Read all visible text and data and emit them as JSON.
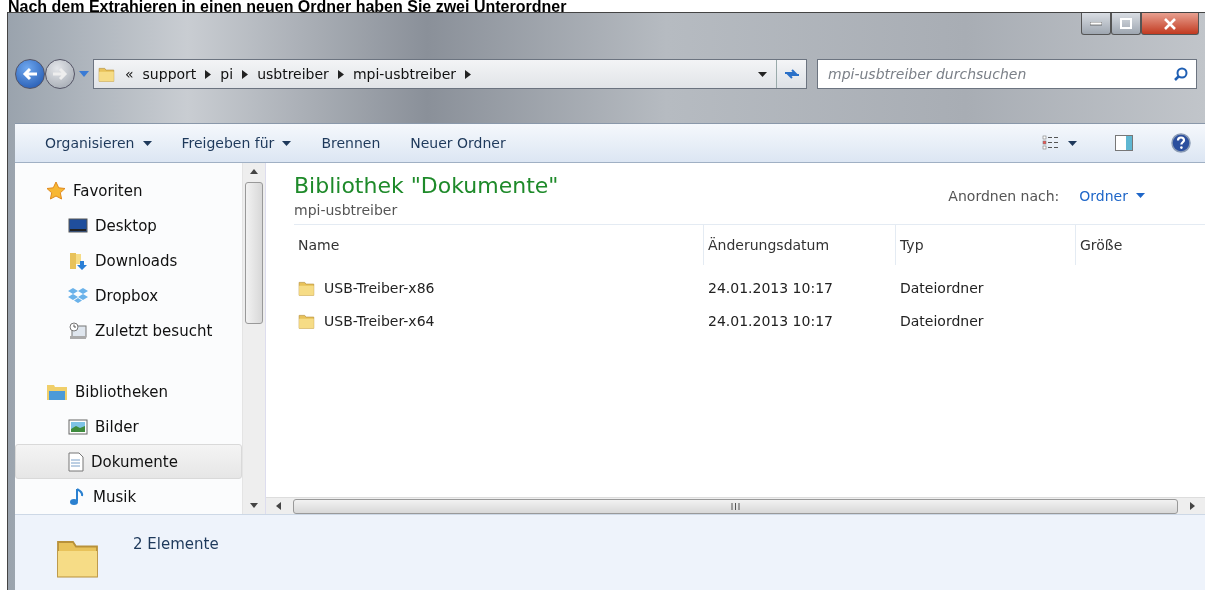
{
  "caption": "Nach dem Extrahieren in einen neuen Ordner haben Sie zwei Unterordner",
  "address": {
    "overflow": "«",
    "crumbs": [
      "support",
      "pi",
      "usbtreiber",
      "mpi-usbtreiber"
    ]
  },
  "search": {
    "placeholder": "mpi-usbtreiber durchsuchen"
  },
  "toolbar": [
    {
      "label": "Organisieren",
      "dropdown": true
    },
    {
      "label": "Freigeben für",
      "dropdown": true
    },
    {
      "label": "Brennen",
      "dropdown": false
    },
    {
      "label": "Neuer Ordner",
      "dropdown": false
    }
  ],
  "nav": [
    {
      "label": "Favoriten",
      "kind": "star",
      "selected": false,
      "children": [
        {
          "label": "Desktop",
          "kind": "desktop",
          "selected": false
        },
        {
          "label": "Downloads",
          "kind": "downloads",
          "selected": false
        },
        {
          "label": "Dropbox",
          "kind": "dropbox",
          "selected": false
        },
        {
          "label": "Zuletzt besucht",
          "kind": "recent",
          "selected": false
        }
      ]
    },
    {
      "label": "Bibliotheken",
      "kind": "library",
      "selected": false,
      "children": [
        {
          "label": "Bilder",
          "kind": "pictures",
          "selected": false
        },
        {
          "label": "Dokumente",
          "kind": "documents",
          "selected": true
        },
        {
          "label": "Musik",
          "kind": "music",
          "selected": false
        }
      ]
    }
  ],
  "library": {
    "title": "Bibliothek \"Dokumente\"",
    "subtitle": "mpi-usbtreiber",
    "arrange_label": "Anordnen nach:",
    "arrange_value": "Ordner"
  },
  "table": {
    "columns": [
      "Name",
      "Änderungsdatum",
      "Typ",
      "Größe"
    ],
    "rows": [
      {
        "name": "USB-Treiber-x86",
        "date": "24.01.2013 10:17",
        "type": "Dateiordner"
      },
      {
        "name": "USB-Treiber-x64",
        "date": "24.01.2013 10:17",
        "type": "Dateiordner"
      }
    ]
  },
  "status_bar": {
    "count": "2 Elemente"
  }
}
